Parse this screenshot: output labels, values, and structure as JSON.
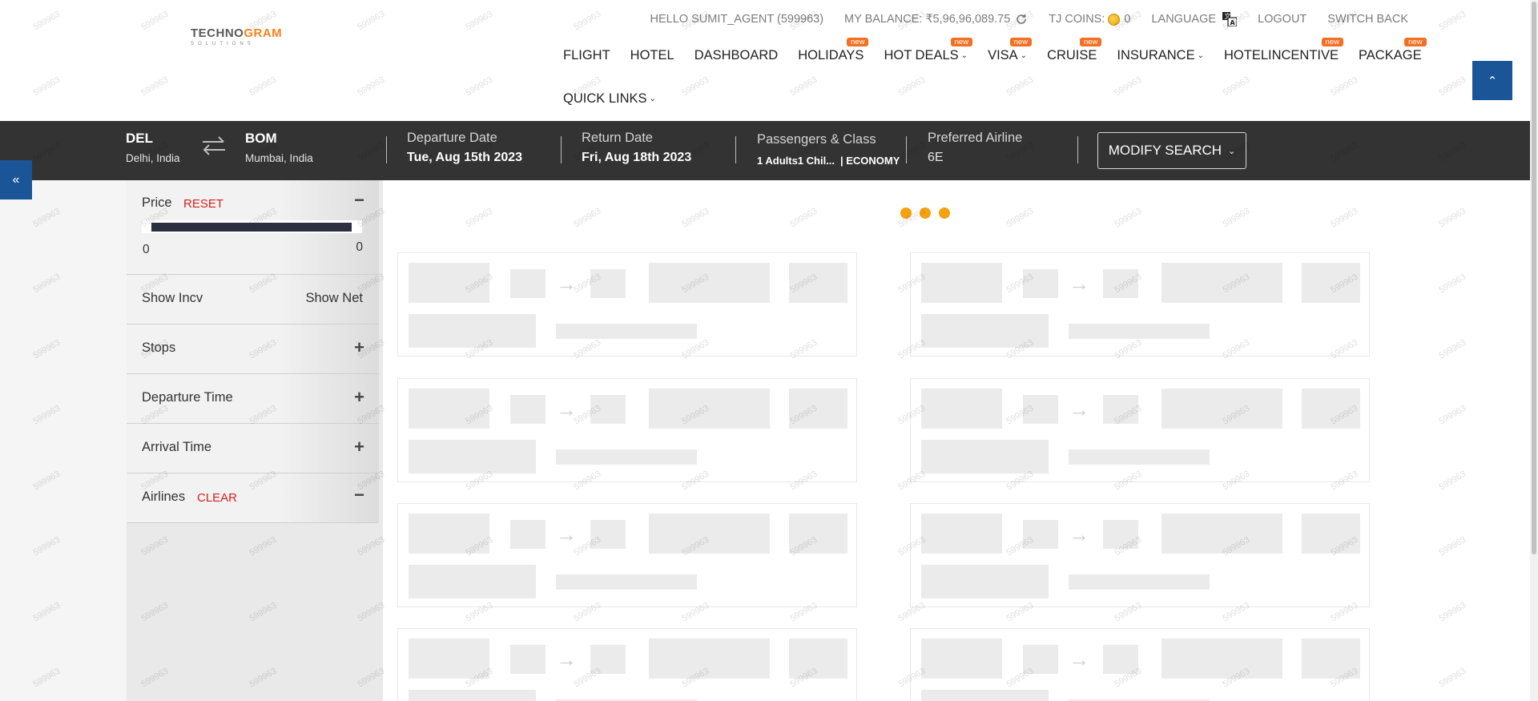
{
  "logo": {
    "brand_main_a": "TECHNO",
    "brand_main_b": "GRAM",
    "brand_sub": "SOLUTIONS"
  },
  "top_bar": {
    "greeting": "HELLO SUMIT_AGENT (599963)",
    "balance": "MY BALANCE: ₹5,96,96,089.75",
    "coins_label": "TJ COINS:",
    "coins_value": "0",
    "language": "LANGUAGE",
    "logout": "LOGOUT",
    "switch_back": "SWITCH BACK"
  },
  "nav": {
    "items": [
      {
        "label": "FLIGHT",
        "badge": "",
        "dropdown": false
      },
      {
        "label": "HOTEL",
        "badge": "",
        "dropdown": false
      },
      {
        "label": "DASHBOARD",
        "badge": "",
        "dropdown": false
      },
      {
        "label": "HOLIDAYS",
        "badge": "new",
        "dropdown": false
      },
      {
        "label": "HOT DEALS",
        "badge": "new",
        "dropdown": true
      },
      {
        "label": "VISA",
        "badge": "new",
        "dropdown": true
      },
      {
        "label": "CRUISE",
        "badge": "new",
        "dropdown": false
      },
      {
        "label": "INSURANCE",
        "badge": "",
        "dropdown": true
      },
      {
        "label": "HOTELINCENTIVE",
        "badge": "new",
        "dropdown": false
      },
      {
        "label": "PACKAGE",
        "badge": "new",
        "dropdown": false
      }
    ],
    "quick_links": "QUICK LINKS"
  },
  "search": {
    "from_code": "DEL",
    "from_city": "Delhi, India",
    "to_code": "BOM",
    "to_city": "Mumbai, India",
    "departure_label": "Departure Date",
    "departure_value": "Tue, Aug 15th 2023",
    "return_label": "Return Date",
    "return_value": "Fri, Aug 18th 2023",
    "pax_label": "Passengers & Class",
    "pax_value": "1 Adults1 Chil...",
    "class_value": "| ECONOMY",
    "airline_label": "Preferred Airline",
    "airline_value": "6E",
    "modify_button": "MODIFY SEARCH"
  },
  "filters": {
    "price_title": "Price",
    "price_reset": "RESET",
    "price_min": "0",
    "price_max": "0",
    "show_incv": "Show Incv",
    "show_net": "Show Net",
    "stops": "Stops",
    "departure_time": "Departure Time",
    "arrival_time": "Arrival Time",
    "airlines_title": "Airlines",
    "airlines_clear": "CLEAR",
    "expand_symbol": "+",
    "collapse_symbol": "−"
  },
  "watermark": "599963",
  "colors": {
    "accent_orange": "#f36f21",
    "brand_blue": "#1a5597",
    "search_bar_bg": "#333333",
    "link_red": "#d32121",
    "loader_dot": "#f5a111"
  }
}
